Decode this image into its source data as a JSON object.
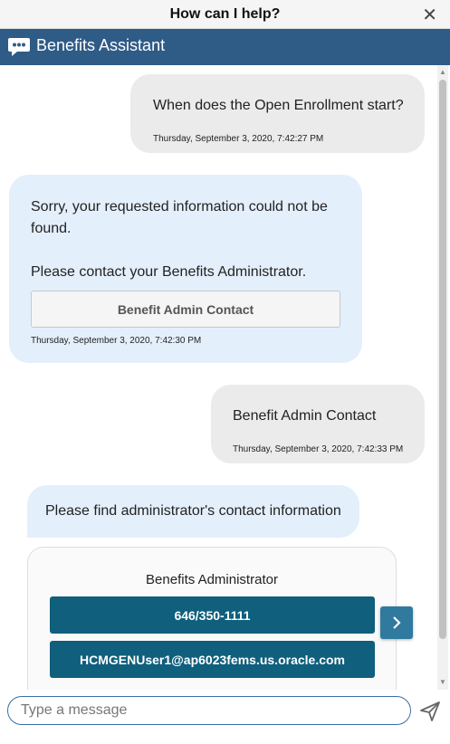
{
  "dialog": {
    "title": "How can I help?",
    "close_glyph": "✕"
  },
  "header": {
    "title": "Benefits Assistant",
    "icon": "chat-bubble-icon",
    "color": "#2f5b87"
  },
  "messages": {
    "m1": {
      "text": "When does the Open Enrollment start?",
      "timestamp": "Thursday, September 3, 2020, 7:42:27 PM"
    },
    "m2": {
      "text": "Sorry, your requested information could not be found.",
      "text2": "Please contact your Benefits Administrator.",
      "option": "Benefit Admin Contact",
      "timestamp": "Thursday, September 3, 2020, 7:42:30 PM"
    },
    "m3": {
      "text": "Benefit Admin Contact",
      "timestamp": "Thursday, September 3, 2020, 7:42:33 PM"
    },
    "m4": {
      "text": "Please find administrator's contact information"
    }
  },
  "card": {
    "title": "Benefits Administrator",
    "phone": "646/350-1111",
    "email": "HCMGENUser1@ap6023fems.us.oracle.com",
    "button_color": "#0f5f7d"
  },
  "composer": {
    "placeholder": "Type a message",
    "send_icon": "send-icon"
  }
}
